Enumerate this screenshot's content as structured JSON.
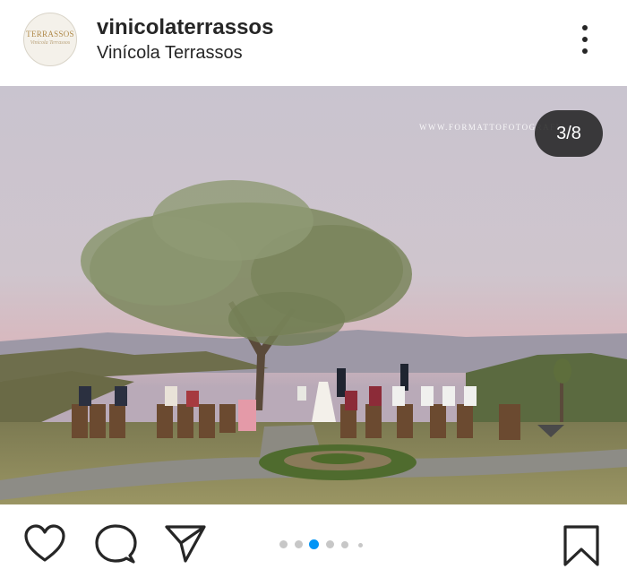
{
  "post": {
    "username": "vinicolaterrassos",
    "location": "Vinícola Terrassos",
    "avatar_title": "TERRASSOS",
    "avatar_subtitle": "Vinícola Terrassos",
    "media_counter": "3/8",
    "watermark": "WWW.FORMATTOFOTOGRAFIA"
  },
  "carousel": {
    "total": 6,
    "active_index": 2
  },
  "icons": {
    "more": "more-options-icon",
    "like": "heart-icon",
    "comment": "comment-icon",
    "share": "paper-plane-icon",
    "save": "bookmark-icon"
  },
  "colors": {
    "text": "#262626",
    "active_dot": "#0095f6",
    "inactive_dot": "#c7c7c7"
  }
}
